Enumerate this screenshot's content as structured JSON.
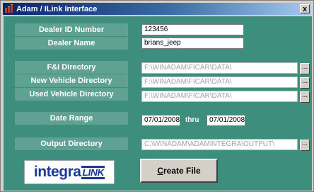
{
  "window": {
    "title": "Adam / ILink Interface",
    "close_label": "x"
  },
  "dealer_id": {
    "label": "Dealer ID Number",
    "value": "123456"
  },
  "dealer_name": {
    "label": "Dealer Name",
    "value": "brians_jeep"
  },
  "fi_dir": {
    "label": "F&I Directory",
    "value": "F:\\WINADAM\\FICAR\\DATA\\"
  },
  "new_vehicle_dir": {
    "label": "New Vehicle Directory",
    "value": "F:\\WINADAM\\FICAR\\DATA\\"
  },
  "used_vehicle_dir": {
    "label": "Used Vehicle Directory",
    "value": "F:\\WINADAM\\FICAR\\DATA\\"
  },
  "date_range": {
    "label": "Date Range",
    "from": "07/01/2008",
    "thru_label": "thru",
    "to": "07/01/2008"
  },
  "output_dir": {
    "label": "Output Directory",
    "value": "C:\\WINADAM\\ADAMINTEGRA\\OUTPUT\\"
  },
  "browse_label": "...",
  "logo": {
    "part1": "integra",
    "part2": "LINK"
  },
  "create_button": {
    "first_letter": "C",
    "rest": "reate File"
  },
  "colors": {
    "panel": "#3e8e7e",
    "label_bg": "#5fa293",
    "logo_blue": "#1f3a93"
  }
}
